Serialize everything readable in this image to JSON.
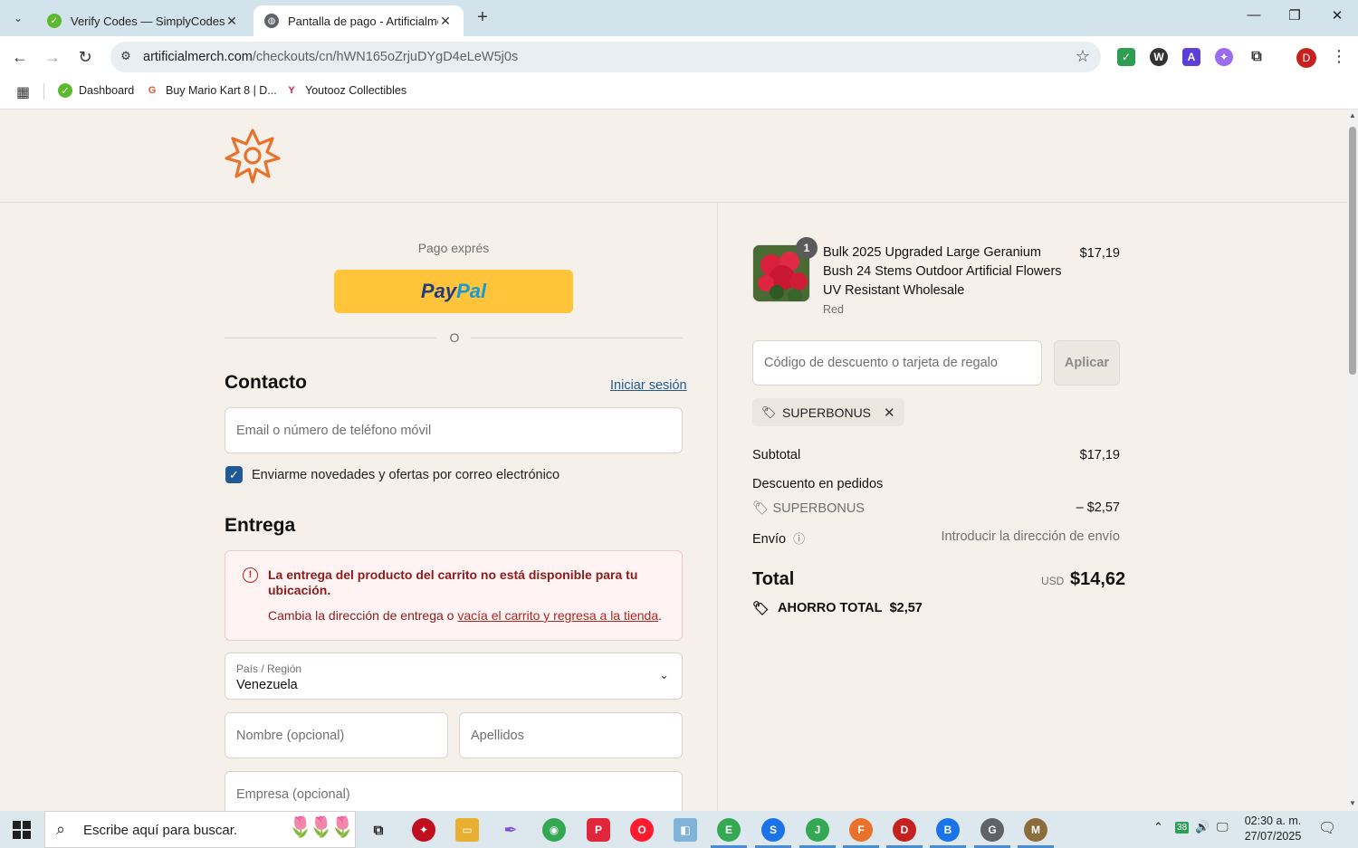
{
  "browser": {
    "tabs": [
      {
        "title": "Verify Codes — SimplyCodes",
        "active": false
      },
      {
        "title": "Pantalla de pago - Artificialmerch",
        "active": true
      }
    ],
    "url_host": "artificialmerch.com",
    "url_path": "/checkouts/cn/hWN165oZrjuDYgD4eLeW5j0s",
    "profile_initial": "D",
    "bookmarks": [
      {
        "label": "Dashboard"
      },
      {
        "label": "Buy Mario Kart 8 | D..."
      },
      {
        "label": "Youtooz Collectibles"
      }
    ]
  },
  "checkout": {
    "express_label": "Pago exprés",
    "paypal_p1": "Pay",
    "paypal_p2": "Pal",
    "or": "O",
    "contact_title": "Contacto",
    "login_link": "Iniciar sesión",
    "email_placeholder": "Email o número de teléfono móvil",
    "newsletter_label": "Enviarme novedades y ofertas por correo electrónico",
    "delivery_title": "Entrega",
    "alert_title": "La entrega del producto del carrito no está disponible para tu ubicación.",
    "alert_body_prefix": "Cambia la dirección de entrega o ",
    "alert_body_link": "vacía el carrito y regresa a la tienda",
    "alert_body_suffix": ".",
    "country_label": "País / Región",
    "country_value": "Venezuela",
    "first_name_placeholder": "Nombre (opcional)",
    "last_name_placeholder": "Apellidos",
    "company_placeholder": "Empresa (opcional)"
  },
  "summary": {
    "quantity_badge": "1",
    "product_name": "Bulk 2025 Upgraded Large Geranium Bush 24 Stems Outdoor Artificial Flowers UV Resistant Wholesale",
    "product_variant": "Red",
    "product_price": "$17,19",
    "discount_placeholder": "Código de descuento o tarjeta de regalo",
    "apply_label": "Aplicar",
    "applied_code": "SUPERBONUS",
    "subtotal_label": "Subtotal",
    "subtotal_value": "$17,19",
    "order_discount_label": "Descuento en pedidos",
    "discount_code": "SUPERBONUS",
    "discount_value": "– $2,57",
    "shipping_label": "Envío",
    "shipping_value": "Introducir la dirección de envío",
    "total_label": "Total",
    "currency": "USD",
    "total_value": "$14,62",
    "savings_label": "AHORRO TOTAL",
    "savings_value": "$2,57"
  },
  "taskbar": {
    "search_placeholder": "Escribe aquí para buscar.",
    "time": "02:30 a. m.",
    "date": "27/07/2025",
    "tray_badge": "38"
  },
  "colors": {
    "page_bg": "#f5f1ea",
    "link": "#1f5a96",
    "paypal_yellow": "#ffc439",
    "alert_red": "#8a1c1c"
  }
}
